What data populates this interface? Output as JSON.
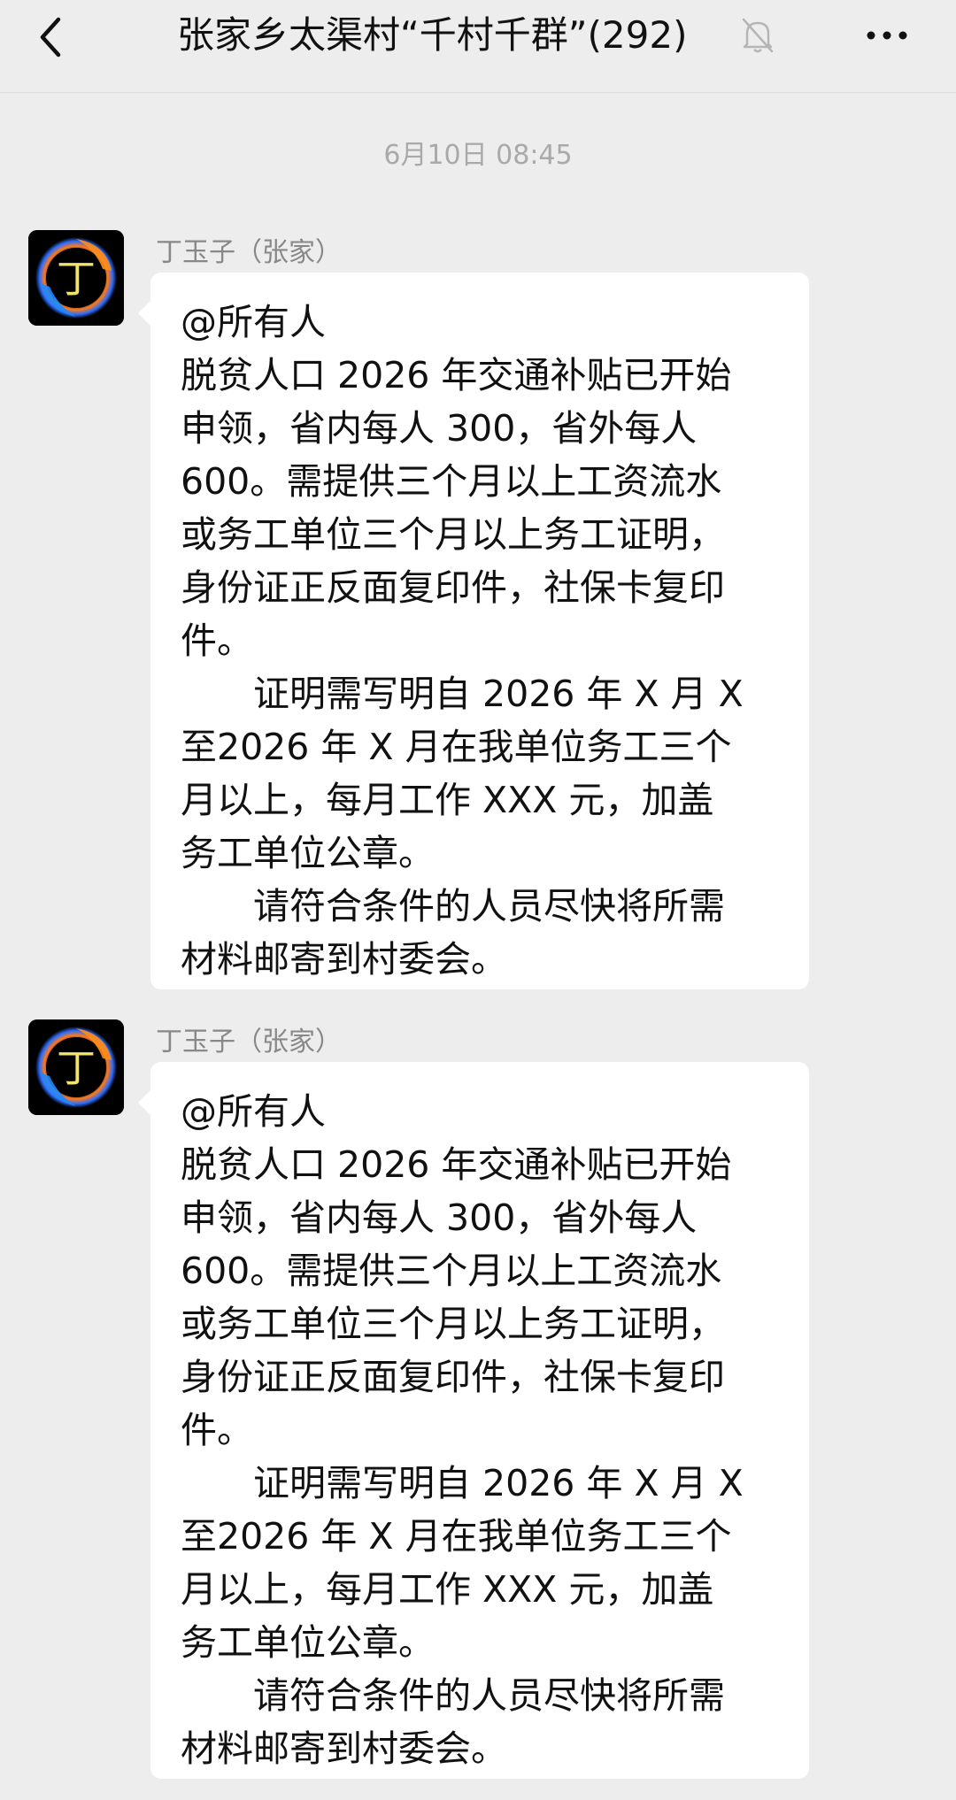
{
  "header": {
    "title": "张家乡太渠村“千村千群”(292)",
    "back_icon": "chevron-left-icon",
    "mute_icon": "bell-off-icon",
    "more_icon": "more-dots-icon"
  },
  "chat": {
    "timestamp": "6月10日 08:45",
    "messages": [
      {
        "sender": "丁玉子（张家）",
        "avatar_char": "丁",
        "lines": [
          "@所有人",
          "脱贫人口 2026 年交通补贴已开始",
          "申领，省内每人 300，省外每人",
          "600。需提供三个月以上工资流水",
          "或务工单位三个月以上务工证明，",
          "身份证正反面复印件，社保卡复印",
          "件。",
          "证明需写明自 2026 年 X 月 X",
          "至2026 年 X 月在我单位务工三个",
          "月以上，每月工作 XXX 元，加盖",
          "务工单位公章。",
          "请符合条件的人员尽快将所需",
          "材料邮寄到村委会。"
        ]
      },
      {
        "sender": "丁玉子（张家）",
        "avatar_char": "丁",
        "lines": [
          "@所有人",
          "脱贫人口 2026 年交通补贴已开始",
          "申领，省内每人 300，省外每人",
          "600。需提供三个月以上工资流水",
          "或务工单位三个月以上务工证明，",
          "身份证正反面复印件，社保卡复印",
          "件。",
          "证明需写明自 2026 年 X 月 X",
          "至2026 年 X 月在我单位务工三个",
          "月以上，每月工作 XXX 元，加盖",
          "务工单位公章。",
          "请符合条件的人员尽快将所需",
          "材料邮寄到村委会。"
        ]
      }
    ]
  }
}
